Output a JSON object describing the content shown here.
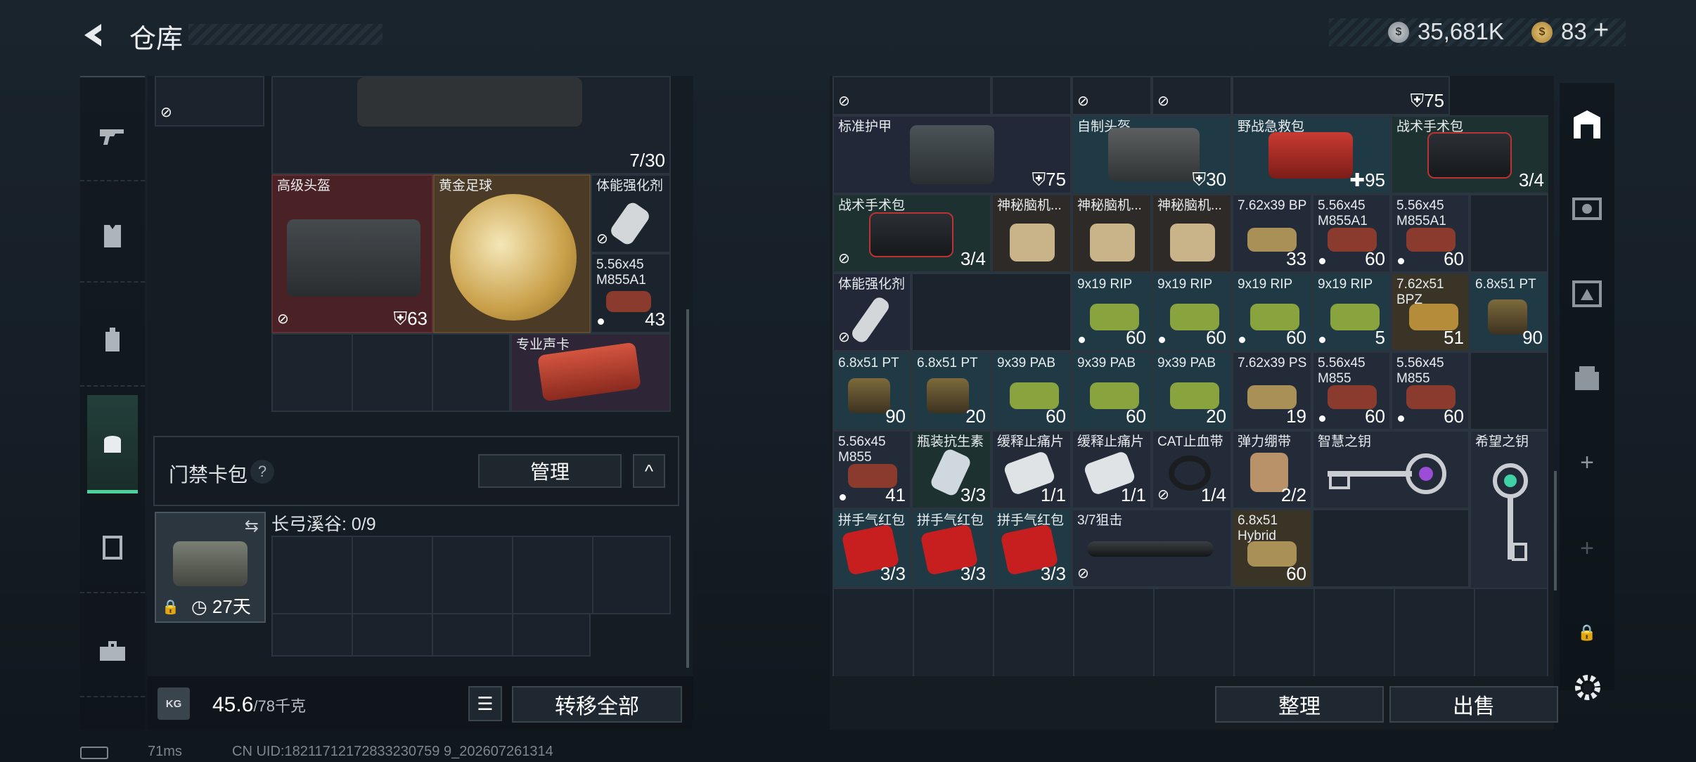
{
  "header": {
    "title": "仓库",
    "currency1_value": "35,681K",
    "currency2_value": "83",
    "plus": "+",
    "back_icon": "back-arrow-icon"
  },
  "left_nav": [
    {
      "icon": "gun-icon"
    },
    {
      "icon": "vest-icon"
    },
    {
      "icon": "backpack-icon"
    },
    {
      "icon": "bag-icon",
      "active": true
    },
    {
      "icon": "case-icon"
    },
    {
      "icon": "toolbox-icon"
    }
  ],
  "left_panel": {
    "weapon_count": "7/30",
    "items": [
      {
        "label": "高级头盔",
        "value": "63",
        "icon": "shield-icon"
      },
      {
        "label": "黄金足球",
        "value": ""
      },
      {
        "label": "体能强化剂",
        "value": ""
      },
      {
        "label": "5.56x45 M855A1",
        "value": "43"
      },
      {
        "label": "专业声卡",
        "value": ""
      }
    ],
    "card_section": {
      "title": "门禁卡包",
      "help": "?",
      "manage": "管理",
      "collapse": "^",
      "slot_label": "长弓溪谷: 0/9",
      "slot_time": "27天",
      "swap_icon": "swap-icon"
    },
    "bottom": {
      "weight_value": "45.6",
      "weight_unit": "/78千克",
      "kg_label": "KG",
      "transfer_all": "转移全部"
    }
  },
  "right_panel": {
    "rows": [
      [
        {
          "label": "",
          "value": ""
        },
        {
          "label": "",
          "value": ""
        },
        {
          "label": "",
          "value": ""
        },
        {
          "label": "",
          "value": ""
        },
        {
          "label": "",
          "value": "75",
          "icon": "shield-icon"
        }
      ],
      [
        {
          "label": "标准护甲",
          "value": "75",
          "icon": "shield-icon"
        },
        {
          "label": "自制头盔",
          "value": "30",
          "icon": "shield-icon"
        },
        {
          "label": "野战急救包",
          "value": "95",
          "icon": "plus-icon"
        },
        {
          "label": "战术手术包",
          "value": "3/4"
        }
      ],
      [
        {
          "label": "战术手术包",
          "value": "3/4"
        },
        {
          "label": "神秘脑机...",
          "value": ""
        },
        {
          "label": "神秘脑机...",
          "value": ""
        },
        {
          "label": "神秘脑机...",
          "value": ""
        },
        {
          "label": "7.62x39 BP",
          "value": "33"
        },
        {
          "label": "5.56x45 M855A1",
          "value": "60"
        },
        {
          "label": "5.56x45 M855A1",
          "value": "60"
        }
      ],
      [
        {
          "label": "体能强化剂",
          "value": ""
        },
        {
          "label": "9x19 RIP",
          "value": "60"
        },
        {
          "label": "9x19 RIP",
          "value": "60"
        },
        {
          "label": "9x19 RIP",
          "value": "60"
        },
        {
          "label": "9x19 RIP",
          "value": "5"
        },
        {
          "label": "7.62x51 BPZ",
          "value": "51"
        },
        {
          "label": "6.8x51 PT",
          "value": "90"
        }
      ],
      [
        {
          "label": "6.8x51 PT",
          "value": "90"
        },
        {
          "label": "6.8x51 PT",
          "value": "20"
        },
        {
          "label": "9x39 PAB",
          "value": "60"
        },
        {
          "label": "9x39 PAB",
          "value": "60"
        },
        {
          "label": "9x39 PAB",
          "value": "20"
        },
        {
          "label": "7.62x39 PS",
          "value": "19"
        },
        {
          "label": "5.56x45 M855",
          "value": "60"
        },
        {
          "label": "5.56x45 M855",
          "value": "60"
        }
      ],
      [
        {
          "label": "5.56x45 M855",
          "value": "41"
        },
        {
          "label": "瓶装抗生素",
          "value": "3/3"
        },
        {
          "label": "缓释止痛片",
          "value": "1/1"
        },
        {
          "label": "缓释止痛片",
          "value": "1/1"
        },
        {
          "label": "CAT止血带",
          "value": "1/4"
        },
        {
          "label": "弹力绷带",
          "value": "2/2"
        },
        {
          "label": "智慧之钥",
          "value": ""
        },
        {
          "label": "希望之钥",
          "value": ""
        }
      ],
      [
        {
          "label": "拼手气红包",
          "value": "3/3"
        },
        {
          "label": "拼手气红包",
          "value": "3/3"
        },
        {
          "label": "拼手气红包",
          "value": "3/3"
        },
        {
          "label": "3/7狙击",
          "value": ""
        },
        {
          "label": "6.8x51 Hybrid",
          "value": "60"
        }
      ]
    ],
    "buttons": {
      "sort": "整理",
      "sell": "出售"
    }
  },
  "right_nav": [
    {
      "icon": "storage-icon"
    },
    {
      "icon": "camera-icon"
    },
    {
      "icon": "map-icon"
    },
    {
      "icon": "box-icon"
    },
    {
      "icon": "plus-icon"
    },
    {
      "icon": "plus-icon"
    },
    {
      "icon": "lock-icon"
    },
    {
      "icon": "gear-icon"
    }
  ],
  "status": {
    "ping": "71ms",
    "uid": "CN UID:18211712172833230759 9_202607261314"
  }
}
